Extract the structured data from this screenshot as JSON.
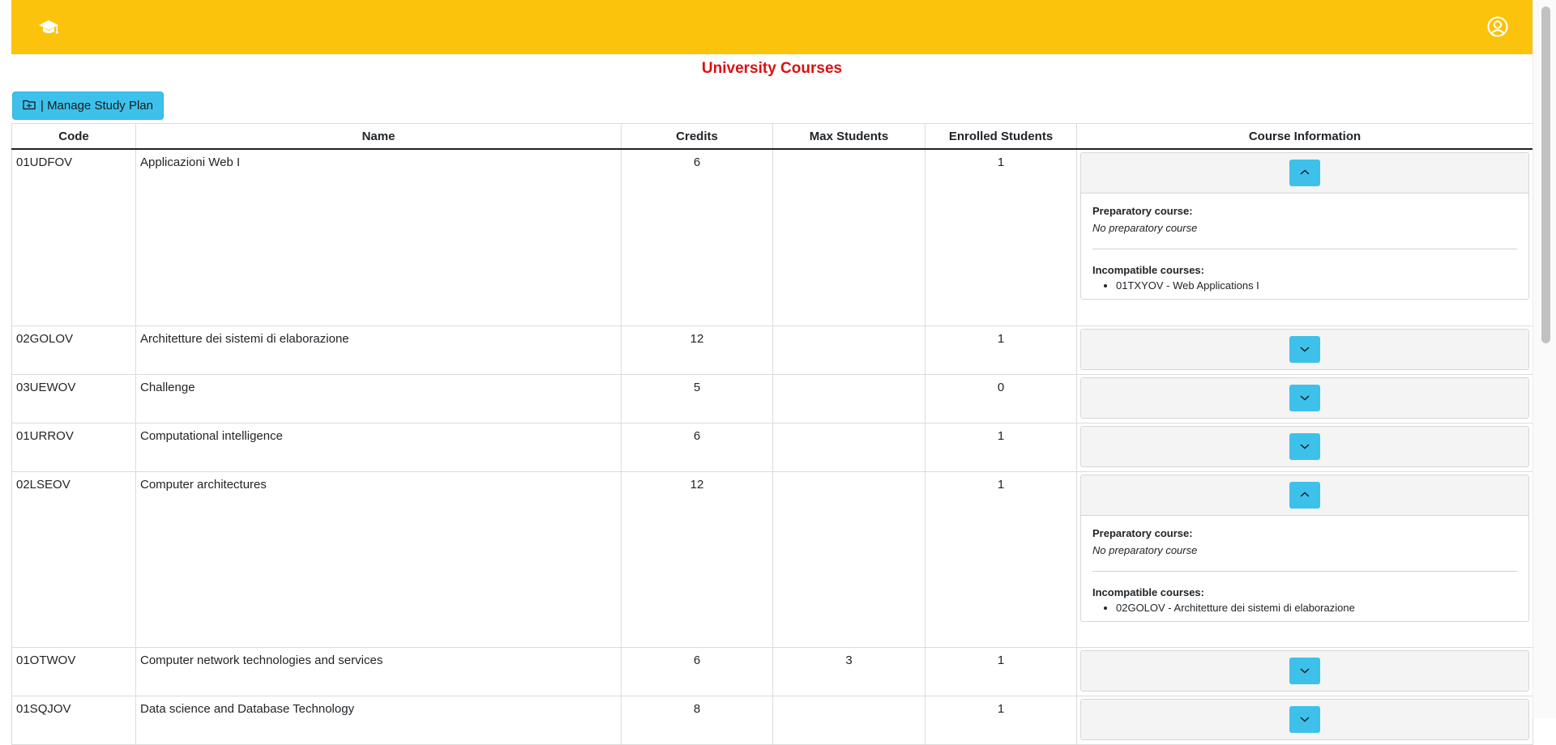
{
  "page_title": "University Courses",
  "manage_button_label": "| Manage Study Plan",
  "icons": {
    "logo": "graduation-cap-icon",
    "user": "user-circle-icon",
    "manage": "folder-icon",
    "expand": "chevron-down-icon",
    "collapse": "chevron-up-icon"
  },
  "colors": {
    "navbar": "#fbc30b",
    "title": "#dc1111",
    "button": "#3dc1ea"
  },
  "table": {
    "headers": {
      "code": "Code",
      "name": "Name",
      "credits": "Credits",
      "max_students": "Max Students",
      "enrolled": "Enrolled Students",
      "info": "Course Information"
    },
    "labels": {
      "preparatory": "Preparatory course:",
      "incompatible": "Incompatible courses:"
    },
    "rows": [
      {
        "code": "01UDFOV",
        "name": "Applicazioni Web I",
        "credits": "6",
        "max": "",
        "enrolled": "1",
        "expanded": true,
        "preparatory": "No preparatory course",
        "incompatible": [
          "01TXYOV - Web Applications I"
        ]
      },
      {
        "code": "02GOLOV",
        "name": "Architetture dei sistemi di elaborazione",
        "credits": "12",
        "max": "",
        "enrolled": "1",
        "expanded": false
      },
      {
        "code": "03UEWOV",
        "name": "Challenge",
        "credits": "5",
        "max": "",
        "enrolled": "0",
        "expanded": false
      },
      {
        "code": "01URROV",
        "name": "Computational intelligence",
        "credits": "6",
        "max": "",
        "enrolled": "1",
        "expanded": false
      },
      {
        "code": "02LSEOV",
        "name": "Computer architectures",
        "credits": "12",
        "max": "",
        "enrolled": "1",
        "expanded": true,
        "preparatory": "No preparatory course",
        "incompatible": [
          "02GOLOV - Architetture dei sistemi di elaborazione"
        ]
      },
      {
        "code": "01OTWOV",
        "name": "Computer network technologies and services",
        "credits": "6",
        "max": "3",
        "enrolled": "1",
        "expanded": false
      },
      {
        "code": "01SQJOV",
        "name": "Data science and Database Technology",
        "credits": "8",
        "max": "",
        "enrolled": "1",
        "expanded": false
      }
    ]
  }
}
